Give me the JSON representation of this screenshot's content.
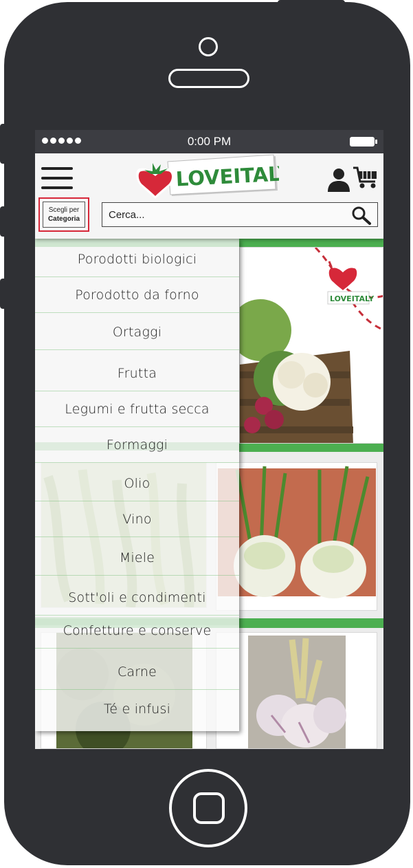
{
  "statusbar": {
    "time": "0:00 PM"
  },
  "header": {
    "logo_text": "LOVEITALY",
    "category_button": {
      "line1": "Scegli per",
      "line2": "Categoria"
    },
    "search": {
      "placeholder": "Cerca..."
    }
  },
  "menu": {
    "items": [
      "Porodotti biologici",
      "Porodotto da forno",
      "Ortaggi",
      "Frutta",
      "Legumi e frutta secca",
      "Formaggi",
      "Olio",
      "Vino",
      "Miele",
      "Sott'oli e condimenti",
      "Confetture e conserve",
      "Carne",
      "Té e infusi"
    ]
  },
  "content": {
    "banner_logo_text": "LOVEITALY"
  },
  "colors": {
    "accent_red": "#d72638",
    "green": "#4caf50",
    "logo_green": "#2e8b3a",
    "phone": "#2f3034"
  }
}
